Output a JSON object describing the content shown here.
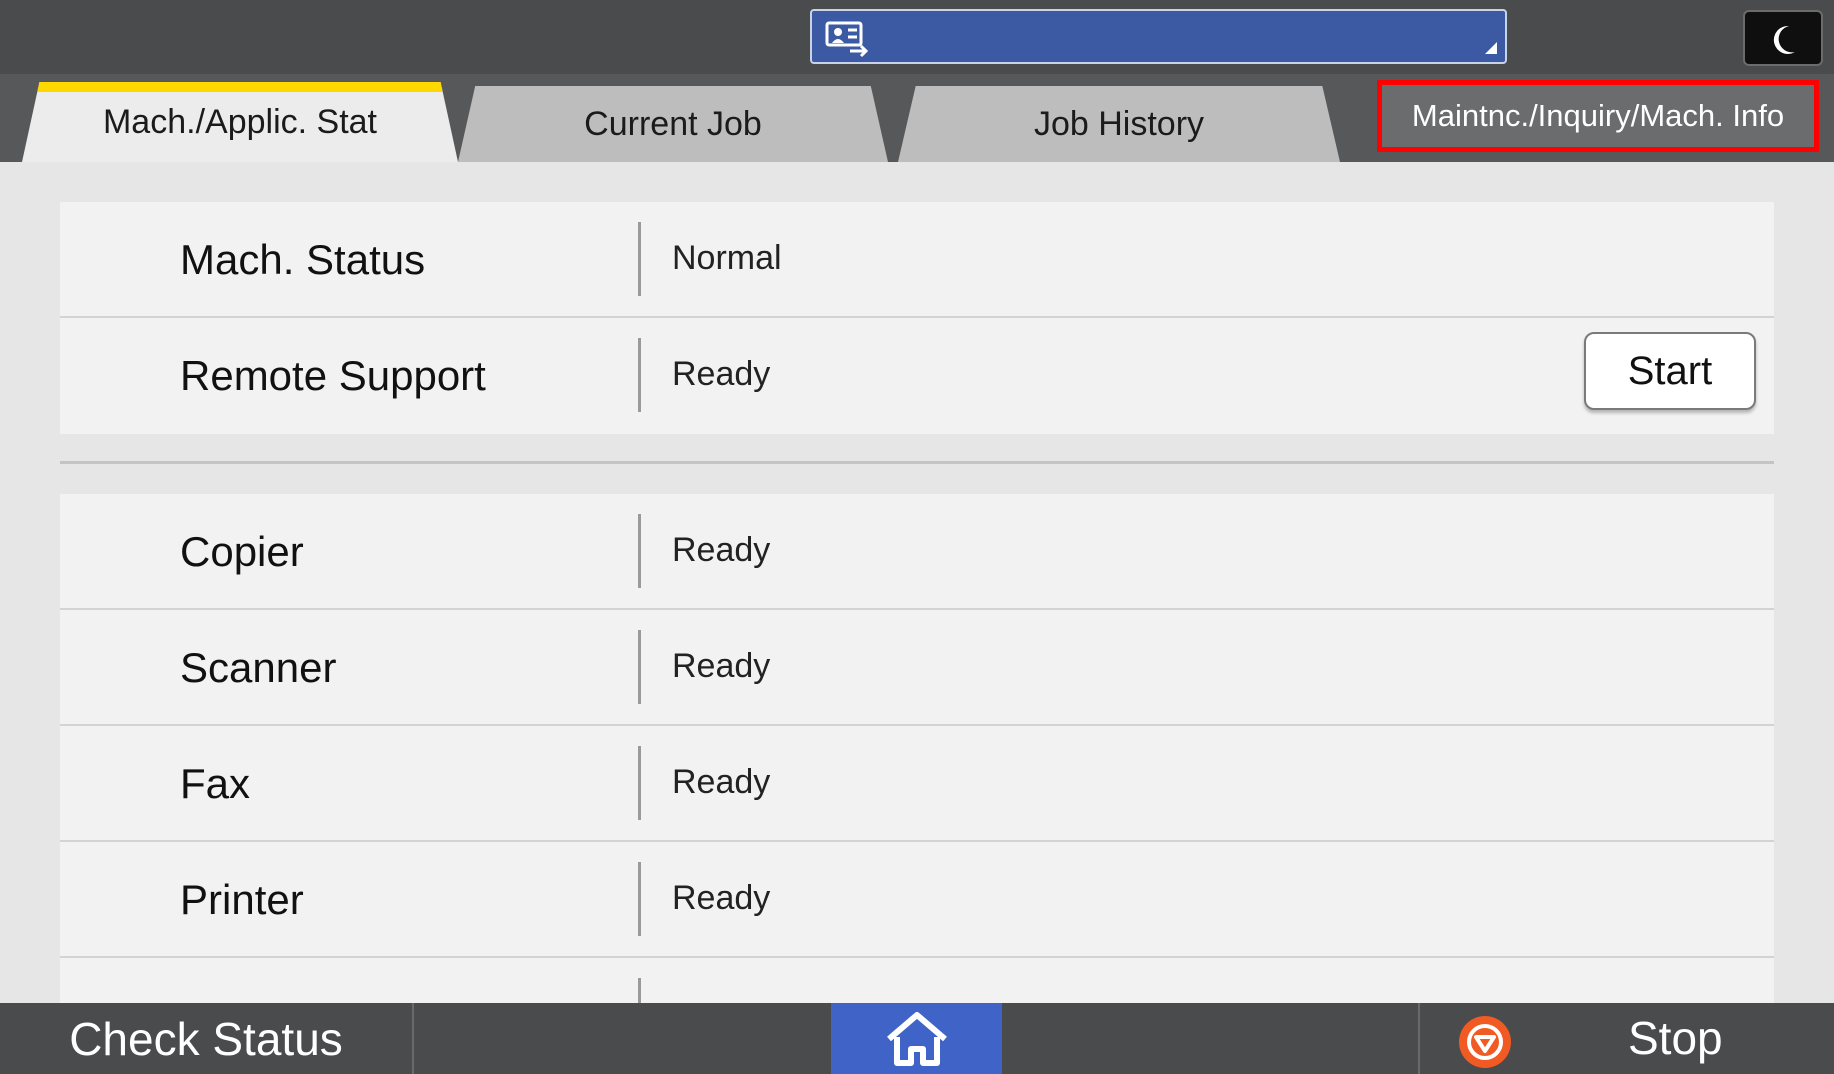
{
  "topbar": {
    "user_select_icon": "login-user-icon",
    "user_select_value": "",
    "energy_icon": "moon-icon"
  },
  "tabs": [
    {
      "label": "Mach./Applic. Stat",
      "active": true
    },
    {
      "label": "Current Job",
      "active": false
    },
    {
      "label": "Job History",
      "active": false
    },
    {
      "label": "Maintnc./Inquiry/Mach. Info",
      "active": false,
      "highlighted": true
    }
  ],
  "status_group_1": [
    {
      "label": "Mach. Status",
      "value": "Normal"
    },
    {
      "label": "Remote Support",
      "value": "Ready",
      "button": "Start"
    }
  ],
  "status_group_2": [
    {
      "label": "Copier",
      "value": "Ready"
    },
    {
      "label": "Scanner",
      "value": "Ready"
    },
    {
      "label": "Fax",
      "value": "Ready"
    },
    {
      "label": "Printer",
      "value": "Ready"
    }
  ],
  "bottombar": {
    "check_status": "Check Status",
    "home_icon": "home-icon",
    "stop_icon": "stop-icon",
    "stop_label": "Stop"
  },
  "colors": {
    "highlight_border": "#ff0000",
    "active_tab_accent": "#ffd800",
    "user_select_bg": "#3b5aa3",
    "home_bg": "#3f63c6",
    "stop_icon": "#f15a22"
  }
}
